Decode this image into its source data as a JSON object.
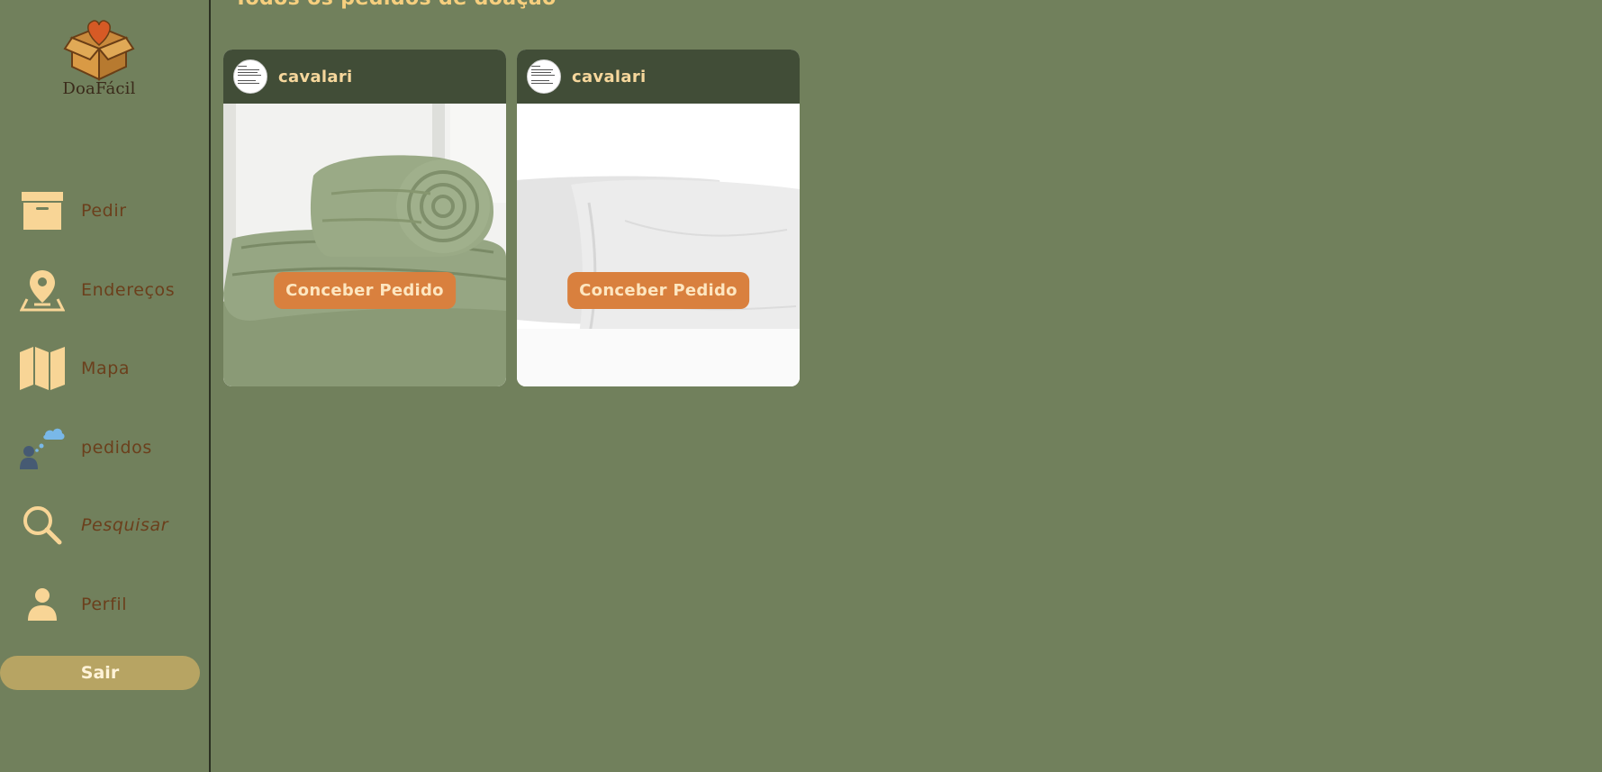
{
  "app": {
    "name": "DoaFácil"
  },
  "header": {
    "title": "Todos os pedidos de doação"
  },
  "sidebar": {
    "items": [
      {
        "label": "Pedir",
        "icon": "archive-box-icon"
      },
      {
        "label": "Endereços",
        "icon": "map-pin-icon"
      },
      {
        "label": "Mapa",
        "icon": "folded-map-icon"
      },
      {
        "label": "pedidos",
        "icon": "person-thinking-icon"
      },
      {
        "label": "Pesquisar",
        "icon": "search-icon"
      },
      {
        "label": "Perfil",
        "icon": "user-icon"
      }
    ],
    "logout_label": "Sair"
  },
  "cards": [
    {
      "username": "cavalari",
      "image": "rolled-green-blanket",
      "action_label": "Conceber Pedido"
    },
    {
      "username": "cavalari",
      "image": "white-pillows",
      "action_label": "Conceber Pedido"
    }
  ],
  "colors": {
    "background": "#71805c",
    "card_header": "#414d37",
    "accent": "#d9803e",
    "icon": "#f8d596",
    "nav_text": "#6b3f1c",
    "logout": "#b7a463",
    "title": "#f6cf7e"
  }
}
